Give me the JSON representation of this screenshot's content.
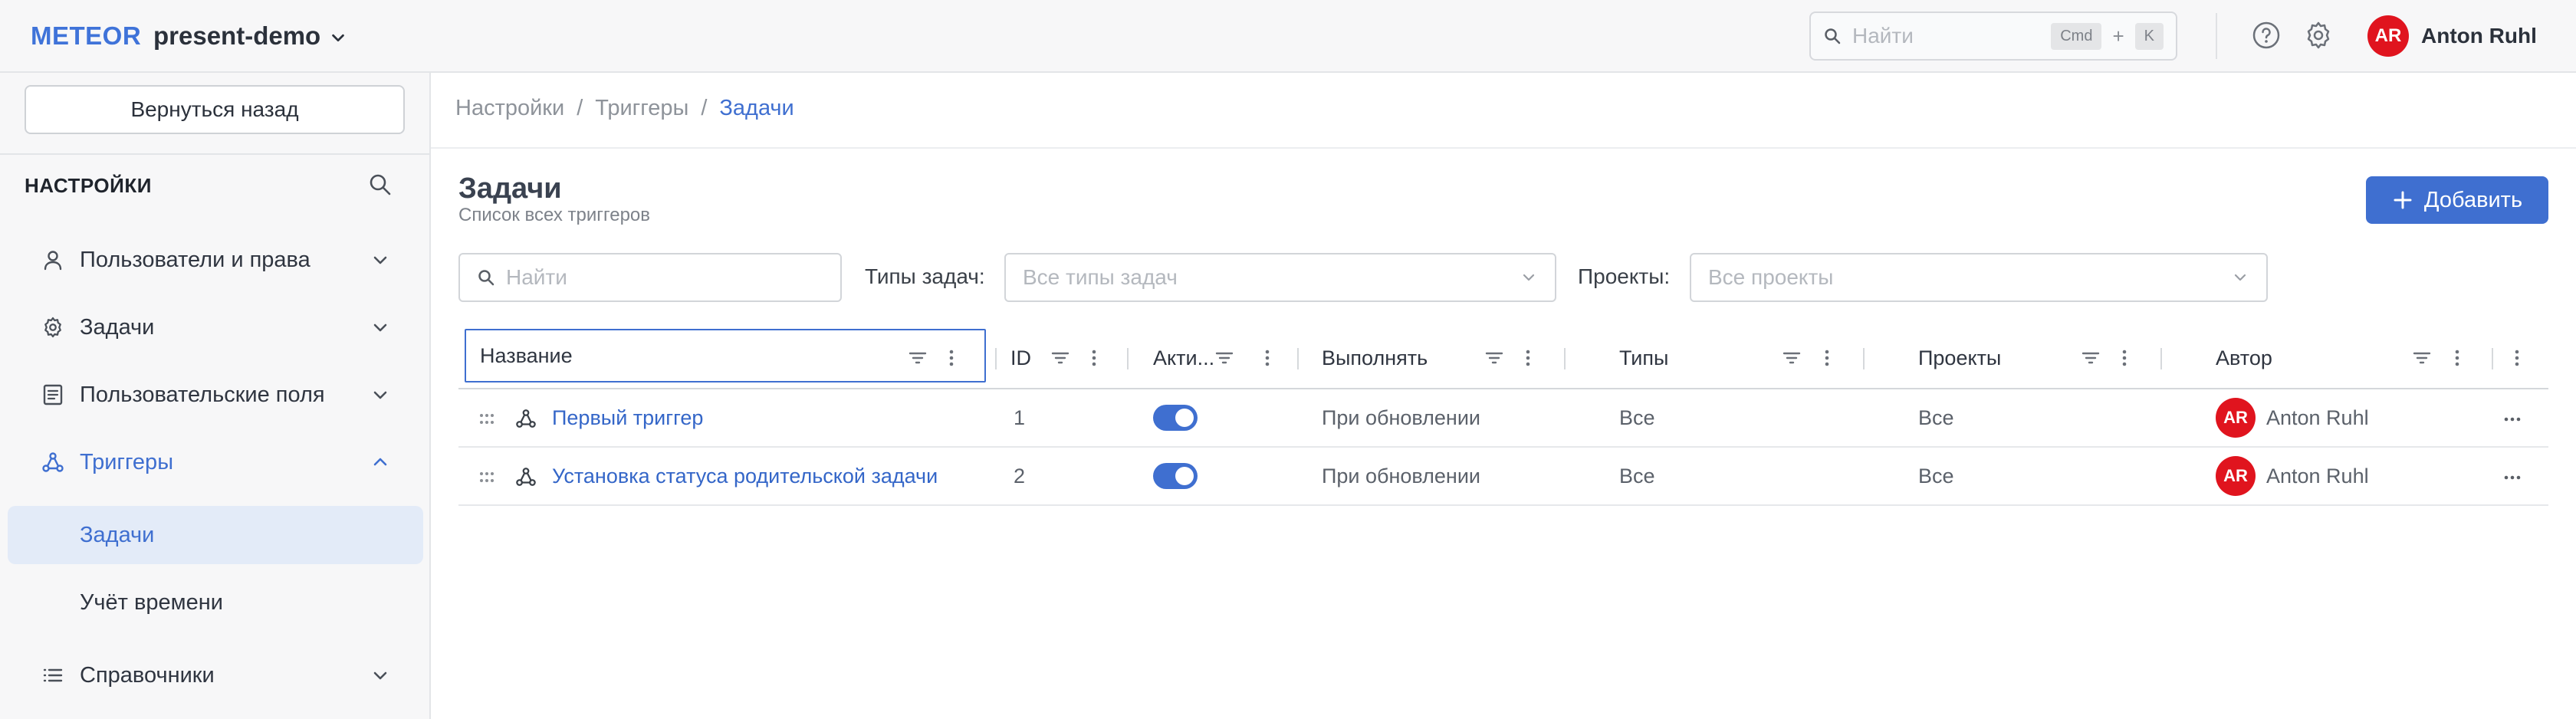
{
  "header": {
    "brand": "METEOR",
    "project": "present-demo",
    "search_placeholder": "Найти",
    "kbd_cmd": "Cmd",
    "kbd_plus": "+",
    "kbd_k": "K",
    "user_initials": "AR",
    "user_name": "Anton Ruhl"
  },
  "sidebar": {
    "back_label": "Вернуться назад",
    "title": "НАСТРОЙКИ",
    "items": [
      {
        "label": "Пользователи и права",
        "icon": "user-icon"
      },
      {
        "label": "Задачи",
        "icon": "gear-icon"
      },
      {
        "label": "Пользовательские поля",
        "icon": "form-icon"
      },
      {
        "label": "Триггеры",
        "icon": "trigger-icon"
      },
      {
        "label": "Справочники",
        "icon": "list-icon"
      }
    ],
    "subitems": [
      {
        "label": "Задачи"
      },
      {
        "label": "Учёт времени"
      }
    ]
  },
  "breadcrumbs": [
    "Настройки",
    "/",
    "Триггеры",
    "/",
    "Задачи"
  ],
  "page": {
    "title": "Задачи",
    "subtitle": "Список всех триггеров",
    "add_label": "Добавить"
  },
  "filters": {
    "search_placeholder": "Найти",
    "task_types_label": "Типы задач:",
    "task_types_placeholder": "Все типы задач",
    "projects_label": "Проекты:",
    "projects_placeholder": "Все проекты"
  },
  "table": {
    "columns": [
      "Название",
      "ID",
      "Акти...",
      "Выполнять",
      "Типы",
      "Проекты",
      "Автор"
    ],
    "rows": [
      {
        "name": "Первый триггер",
        "id": "1",
        "active": true,
        "run": "При обновлении",
        "types": "Все",
        "projects": "Все",
        "author_initials": "AR",
        "author": "Anton Ruhl"
      },
      {
        "name": "Установка статуса родительской задачи",
        "id": "2",
        "active": true,
        "run": "При обновлении",
        "types": "Все",
        "projects": "Все",
        "author_initials": "AR",
        "author": "Anton Ruhl"
      }
    ]
  },
  "colors": {
    "accent": "#3f6fd0",
    "avatar": "#e0141e"
  }
}
